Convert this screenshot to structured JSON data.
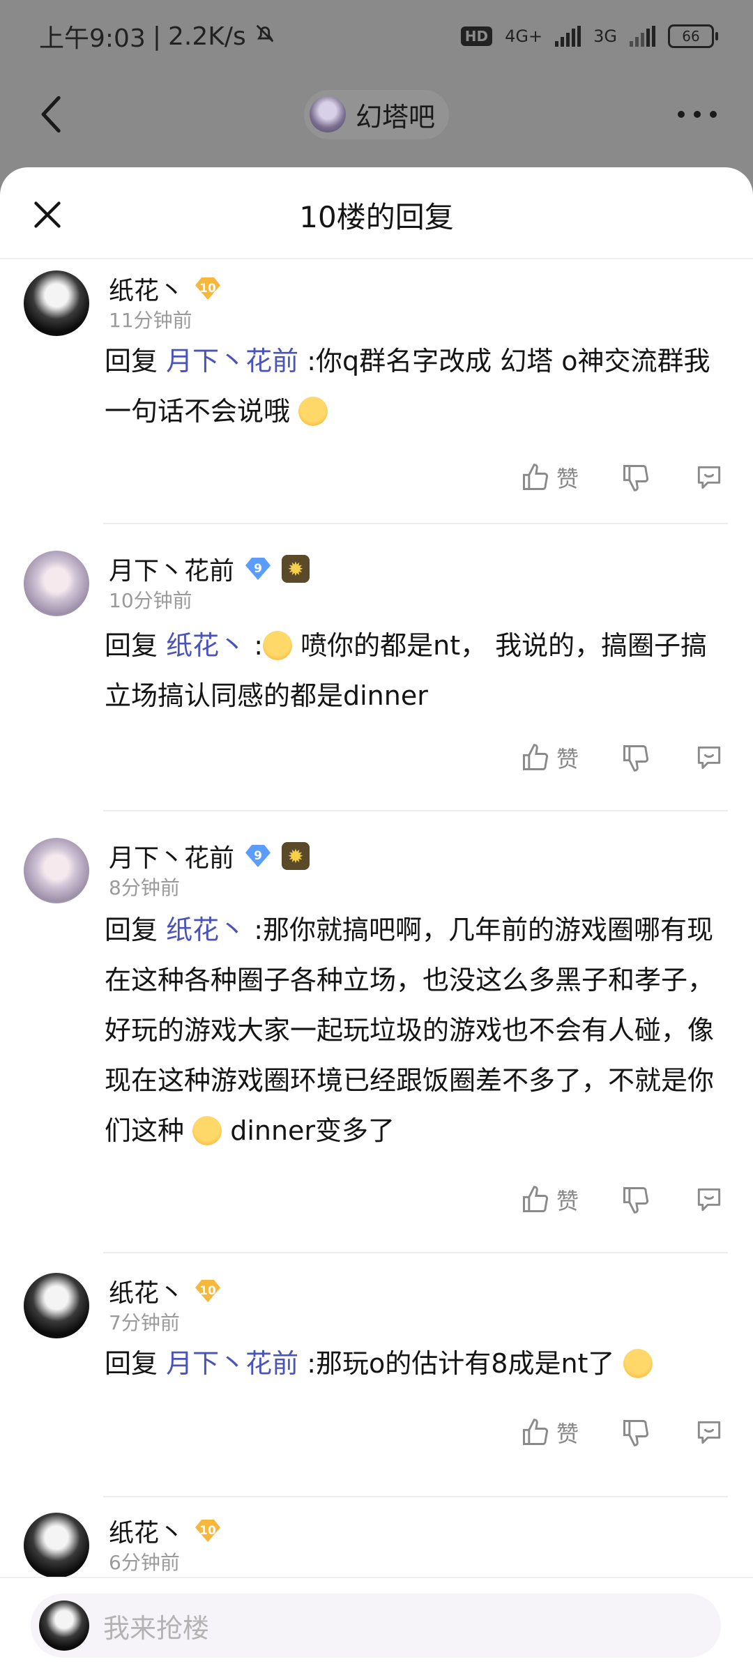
{
  "status_bar": {
    "time": "上午9:03",
    "speed": "2.2K/s",
    "hd": "HD",
    "net1": "4G+",
    "net2": "3G",
    "battery": "66"
  },
  "header": {
    "forum_name": "幻塔吧"
  },
  "sheet": {
    "title": "10楼的回复"
  },
  "comments": [
    {
      "user": "纸花丶",
      "level": "10",
      "time": "11分钟前",
      "prefix": "回复",
      "mention": "月下丶花前",
      "text": ":你q群名字改成 幻塔 o神交流群我一句话不会说哦",
      "like_label": "赞"
    },
    {
      "user": "月下丶花前",
      "level": "9",
      "time": "10分钟前",
      "prefix": "回复",
      "mention": "纸花丶",
      "text": " 喷你的都是nt， 我说的，搞圈子搞立场搞认同感的都是dinner",
      "like_label": "赞"
    },
    {
      "user": "月下丶花前",
      "level": "9",
      "time": "8分钟前",
      "prefix": "回复",
      "mention": "纸花丶",
      "text": ":那你就搞吧啊，几年前的游戏圈哪有现在这种各种圈子各种立场，也没这么多黑子和孝子，好玩的游戏大家一起玩垃圾的游戏也不会有人碰，像现在这种游戏圈环境已经跟饭圈差不多了，不就是你们这种",
      "text_tail": "dinner变多了",
      "like_label": "赞"
    },
    {
      "user": "纸花丶",
      "level": "10",
      "time": "7分钟前",
      "prefix": "回复",
      "mention": "月下丶花前",
      "text": ":那玩o的估计有8成是nt了",
      "like_label": "赞"
    },
    {
      "user": "纸花丶",
      "level": "10",
      "time": "6分钟前"
    }
  ],
  "reply_bar": {
    "placeholder": "我来抢楼"
  }
}
